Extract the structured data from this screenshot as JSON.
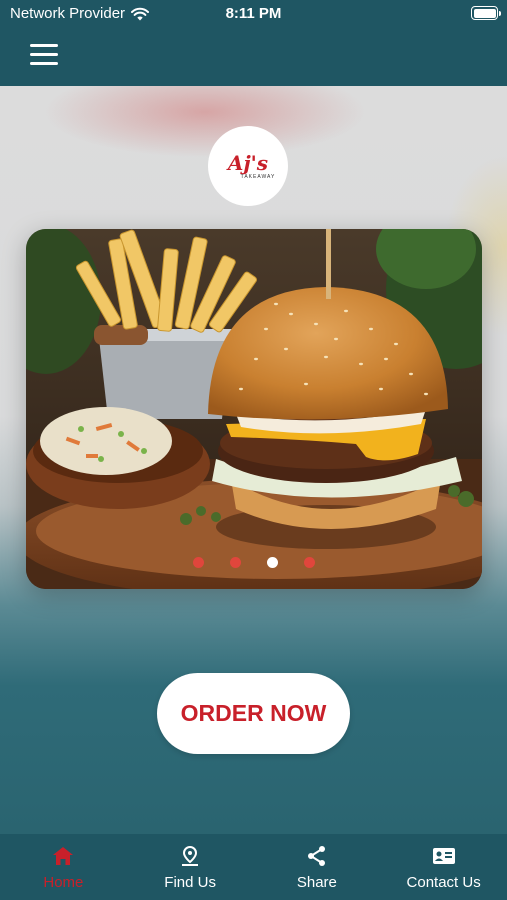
{
  "status_bar": {
    "carrier": "Network Provider",
    "time": "8:11 PM"
  },
  "header": {
    "menu_icon": "hamburger-menu-icon"
  },
  "logo": {
    "brand": "Aj's",
    "tagline": "TAKEAWAY"
  },
  "carousel": {
    "slide_count": 4,
    "active_index": 2
  },
  "order_button": {
    "label": "ORDER NOW"
  },
  "tab_bar": {
    "items": [
      {
        "label": "Home",
        "icon": "home-icon",
        "active": true
      },
      {
        "label": "Find Us",
        "icon": "location-pin-icon",
        "active": false
      },
      {
        "label": "Share",
        "icon": "share-icon",
        "active": false
      },
      {
        "label": "Contact Us",
        "icon": "contact-card-icon",
        "active": false
      }
    ]
  },
  "colors": {
    "primary": "#1f5663",
    "accent": "#c8202a",
    "inactive_dot": "#e0463c"
  }
}
